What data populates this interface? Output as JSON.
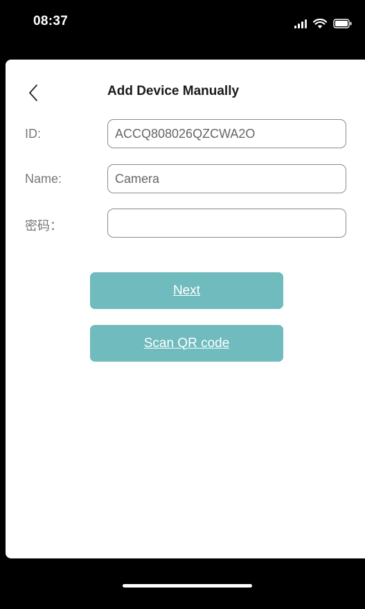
{
  "status_bar": {
    "time": "08:37",
    "icons": [
      "signal-icon",
      "wifi-icon",
      "battery-icon"
    ]
  },
  "header": {
    "back_icon": "chevron-left-icon",
    "title": "Add Device Manually"
  },
  "form": {
    "id": {
      "label": "ID:",
      "value": "ACCQ808026QZCWA2O"
    },
    "name": {
      "label": "Name:",
      "value": "Camera"
    },
    "password": {
      "label": "密码：",
      "value": ""
    }
  },
  "buttons": {
    "next_label": "Next",
    "scan_label": "Scan QR code"
  },
  "colors": {
    "accent": "#6fbbbd",
    "background": "#ffffff",
    "chrome": "#000000"
  }
}
